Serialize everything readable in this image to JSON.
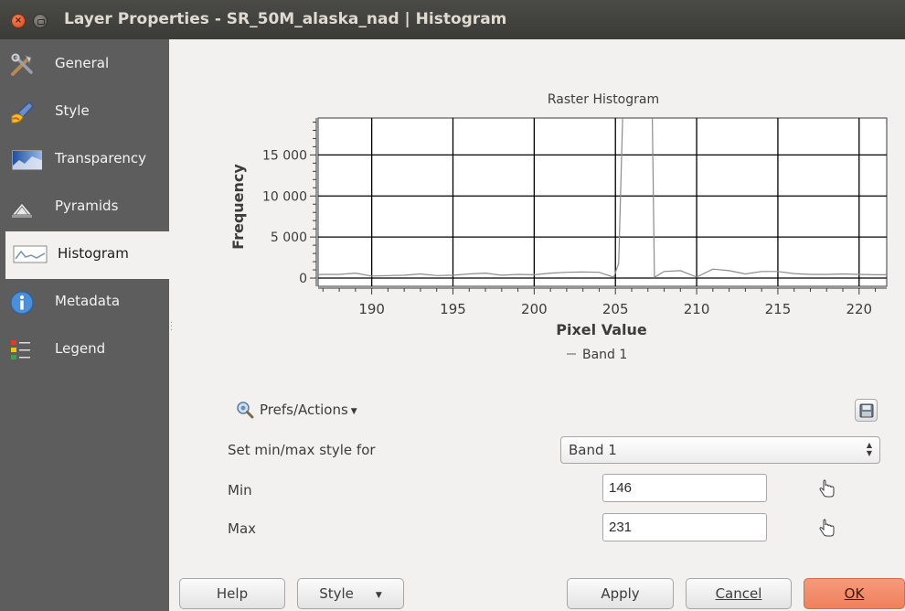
{
  "window": {
    "title": "Layer Properties - SR_50M_alaska_nad | Histogram"
  },
  "sidebar": {
    "items": [
      {
        "label": "General",
        "icon": "tools-icon",
        "active": false
      },
      {
        "label": "Style",
        "icon": "paintbrush-icon",
        "active": false
      },
      {
        "label": "Transparency",
        "icon": "transparency-icon",
        "active": false
      },
      {
        "label": "Pyramids",
        "icon": "pyramids-icon",
        "active": false
      },
      {
        "label": "Histogram",
        "icon": "histogram-icon",
        "active": true
      },
      {
        "label": "Metadata",
        "icon": "info-icon",
        "active": false
      },
      {
        "label": "Legend",
        "icon": "legend-icon",
        "active": false
      }
    ]
  },
  "chart_data": {
    "type": "line",
    "title": "Raster Histogram",
    "xlabel": "Pixel Value",
    "ylabel": "Frequency",
    "xlim": [
      186.7,
      221.7
    ],
    "ylim": [
      -1000,
      19500
    ],
    "xticks": [
      "190",
      "195",
      "200",
      "205",
      "210",
      "215",
      "220"
    ],
    "yticks": [
      "0",
      "5 000",
      "10 000",
      "15 000"
    ],
    "grid": true,
    "legend": "bottom",
    "series": [
      {
        "name": "Band 1",
        "color": "#8c8c8c",
        "x": [
          186.7,
          187,
          188,
          189,
          190,
          191,
          192,
          193,
          194,
          195,
          196,
          197,
          198,
          199,
          200,
          201,
          202,
          203,
          204,
          204.9,
          205.2,
          206,
          207,
          207.4,
          208,
          209,
          210,
          211,
          212,
          213,
          214,
          215,
          216,
          217,
          218,
          219,
          220,
          221,
          221.7
        ],
        "y": [
          400,
          450,
          450,
          600,
          250,
          300,
          350,
          500,
          300,
          350,
          500,
          600,
          350,
          450,
          400,
          600,
          700,
          750,
          700,
          100,
          1800,
          60000,
          60000,
          80,
          800,
          900,
          120,
          1100,
          900,
          500,
          800,
          800,
          550,
          450,
          450,
          500,
          450,
          400,
          400
        ]
      }
    ]
  },
  "prefs": {
    "label": "Prefs/Actions",
    "icon": "zoom-magnifier-icon",
    "save_icon": "save-disk-icon"
  },
  "minmax": {
    "style_label": "Set min/max style for",
    "band_selected": "Band 1",
    "min_label": "Min",
    "min_value": "146",
    "max_label": "Max",
    "max_value": "231",
    "pick_icon": "hand-pointer-icon"
  },
  "buttons": {
    "help": "Help",
    "style": "Style",
    "apply": "Apply",
    "cancel": "Cancel",
    "ok": "OK"
  },
  "colors": {
    "accent_ok": "#f0805c",
    "sidebar_bg": "#5d5d5d",
    "titlebar_bg": "#3c3b37"
  }
}
